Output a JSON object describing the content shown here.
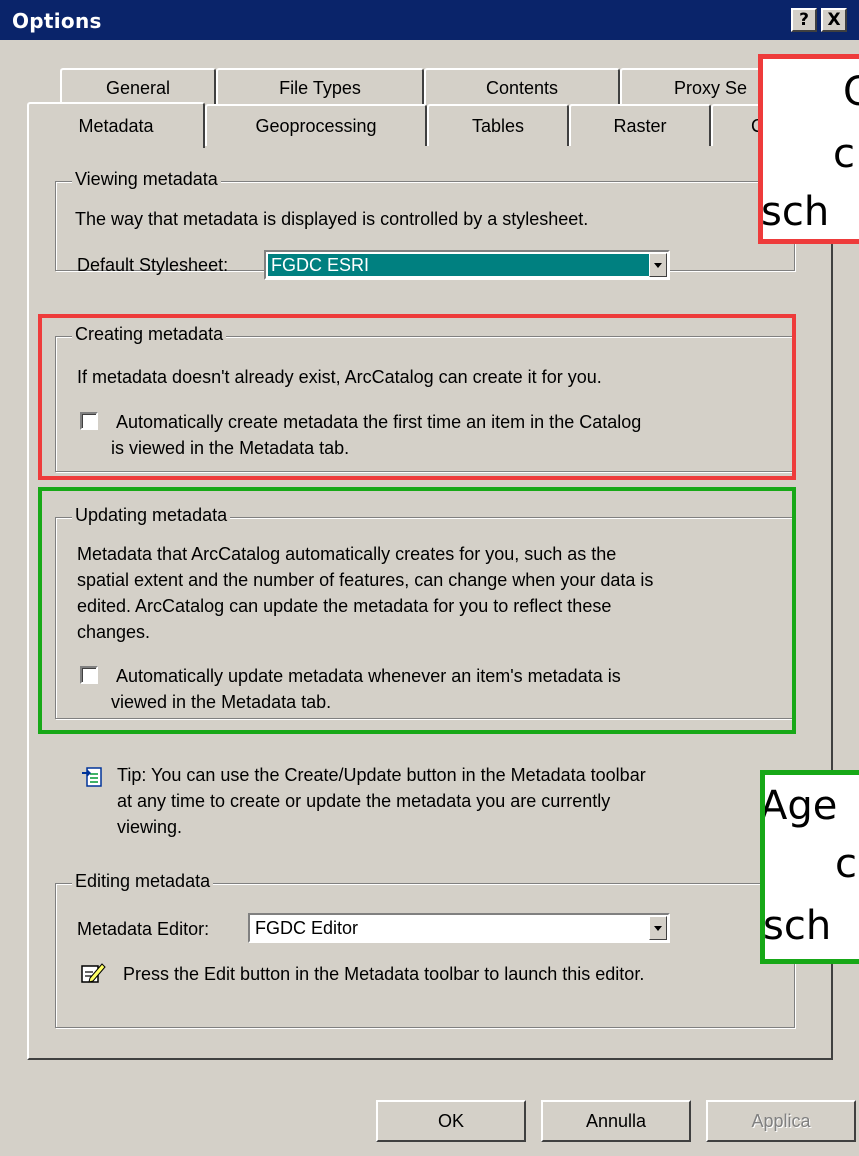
{
  "window": {
    "title": "Options",
    "help_glyph": "?",
    "close_glyph": "X"
  },
  "tabs": {
    "back_row": [
      "General",
      "File Types",
      "Contents",
      "Proxy Se"
    ],
    "front_row": [
      "Metadata",
      "Geoprocessing",
      "Tables",
      "Raster",
      "C"
    ]
  },
  "viewing": {
    "legend": "Viewing metadata",
    "description": "The way that metadata is displayed is controlled by a stylesheet.",
    "stylesheet_label": "Default Stylesheet:",
    "stylesheet_value": "FGDC ESRI"
  },
  "creating": {
    "legend": "Creating metadata",
    "description": "If metadata doesn't already exist, ArcCatalog can create it for you.",
    "checkbox_line1": "Automatically create metadata the first time an item in the Catalog",
    "checkbox_line2": "is viewed in the Metadata tab."
  },
  "updating": {
    "legend": "Updating metadata",
    "desc_line1": "Metadata that ArcCatalog automatically creates for you, such as the",
    "desc_line2": "spatial extent and the number of features, can change when your data is",
    "desc_line3": "edited.  ArcCatalog can update the metadata for you to reflect these",
    "desc_line4": "changes.",
    "checkbox_line1": "Automatically update metadata whenever an item's metadata is",
    "checkbox_line2": "viewed in the Metadata tab."
  },
  "tip": {
    "line1": "Tip: You can use the Create/Update button in the Metadata toolbar",
    "line2": "at any time to create or update the metadata you are currently",
    "line3": "viewing."
  },
  "editing": {
    "legend": "Editing metadata",
    "editor_label": "Metadata Editor:",
    "editor_value": "FGDC Editor",
    "hint": "Press the Edit button in the Metadata toolbar to launch this editor."
  },
  "buttons": {
    "ok": "OK",
    "cancel": "Annulla",
    "apply": "Applica"
  },
  "overlays": {
    "red": [
      "C",
      "c",
      "sch"
    ],
    "green": [
      "Age",
      "c",
      "sch"
    ]
  },
  "colors": {
    "titlebar": "#0a246a",
    "selection": "#008080",
    "red_highlight": "#ee3b3b",
    "green_highlight": "#17a817"
  }
}
